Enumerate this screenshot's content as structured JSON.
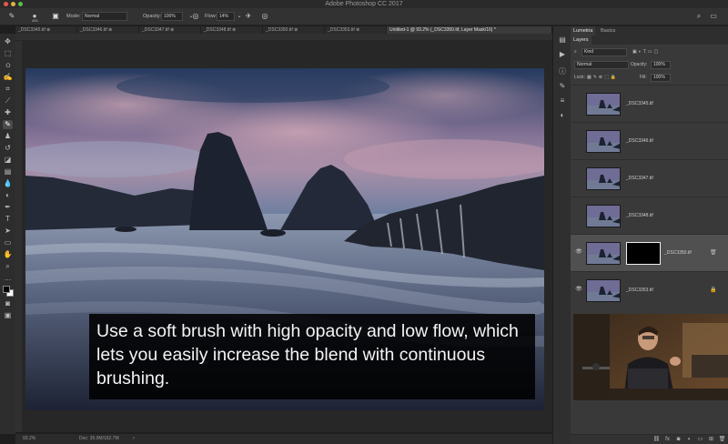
{
  "window": {
    "title": "Adobe Photoshop CC 2017"
  },
  "options_bar": {
    "brush_size": "400",
    "mode_label": "Mode:",
    "mode_value": "Normal",
    "opacity_label": "Opacity:",
    "opacity_value": "100%",
    "flow_label": "Flow:",
    "flow_value": "14%"
  },
  "tabs": [
    {
      "label": "_DSC3345.tif ⊗"
    },
    {
      "label": "_DSC3346.tif ⊗"
    },
    {
      "label": "_DSC3347.tif ⊗"
    },
    {
      "label": "_DSC3348.tif ⊗"
    },
    {
      "label": "_DSC3350.tif ⊗"
    },
    {
      "label": "_DSC3353.tif ⊗"
    },
    {
      "label": "Untitled-1 @ 93.2% (_DSC3350.tif, Layer Mask/16) *"
    }
  ],
  "subtitle": {
    "text": "Use a soft brush with high opacity and low flow, which lets you easily increase the blend with continuous brushing."
  },
  "status": {
    "zoom": "93.2%",
    "doc": "Doc: 35.0M/162.7M"
  },
  "panels": {
    "tab1": "Lumetria",
    "tab2": "Basics",
    "layers_tab": "Layers",
    "kind_label": "Kind",
    "blend_mode": "Normal",
    "opacity_label": "Opacity:",
    "opacity_value": "100%",
    "lock_label": "Lock:",
    "fill_label": "Fill:",
    "fill_value": "100%"
  },
  "layers": [
    {
      "name": "_DSC3345.tif"
    },
    {
      "name": "_DSC3346.tif"
    },
    {
      "name": "_DSC3347.tif"
    },
    {
      "name": "_DSC3348.tif"
    },
    {
      "name": "_DSC3350.tif"
    },
    {
      "name": "_DSC3353.tif"
    }
  ],
  "icons": [
    "brush-icon",
    "gear-icon",
    "move-icon",
    "marquee-icon",
    "lasso-icon",
    "crop-icon",
    "eyedropper-icon",
    "healing-icon",
    "brush-tool-icon",
    "stamp-icon",
    "history-brush-icon",
    "eraser-icon",
    "gradient-icon",
    "blur-icon",
    "dodge-icon",
    "pen-icon",
    "type-icon",
    "path-select-icon",
    "shape-icon",
    "hand-icon",
    "zoom-icon",
    "search-icon",
    "workspace-icon",
    "eye-icon",
    "lock-icon"
  ],
  "colors": {
    "foreground": "#000000",
    "background": "#ffffff",
    "accent": "#505050"
  }
}
